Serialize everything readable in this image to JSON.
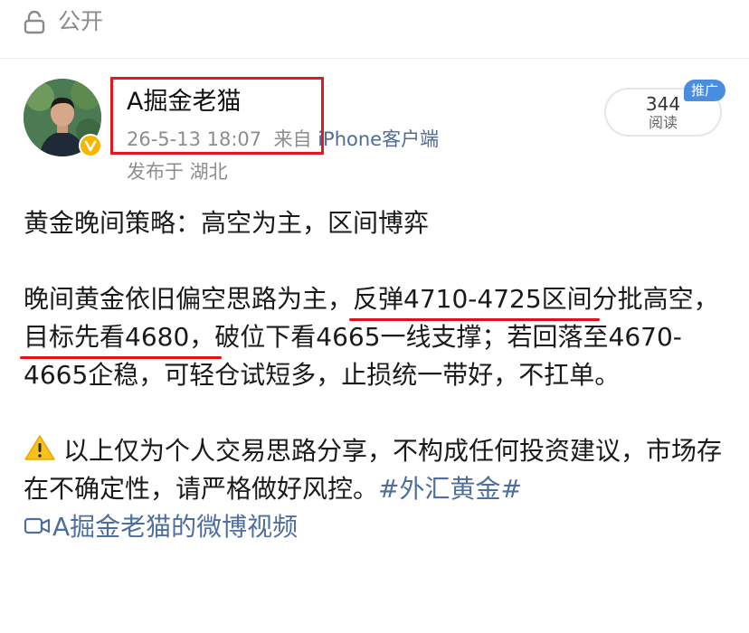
{
  "header": {
    "visibility_label": "公开",
    "visibility_icon": "lock-icon"
  },
  "post": {
    "author": "A掘金老猫",
    "timestamp": "26-5-13 18:07",
    "source_prefix": "来自",
    "source": "iPhone客户端",
    "location": "发布于 湖北",
    "views": {
      "count": "344",
      "label": "阅读"
    },
    "promo_badge": "推广",
    "title_line": "黄金晚间策略：高空为主，区间博弈",
    "body": {
      "seg1": "晚间黄金依旧偏空思路为主，",
      "seg2": "反弹4710-4725区间",
      "seg3": "分批高空，",
      "seg4": "目标先看4680，",
      "seg5": "破位下看4665一线支撑；若回落至4670-4665企稳，可轻仓试短多，止损统一带好，不扛单。"
    },
    "disclaimer_icon": "warning-icon",
    "disclaimer": "以上仅为个人交易思路分享，不构成任何投资建议，市场存在不确定性，请严格做好风控。",
    "topic": "#外汇黄金#",
    "video_link": "A掘金老猫的微博视频",
    "video_icon": "video-camera-icon"
  },
  "colors": {
    "highlight": "#e4191f",
    "link": "#4d6e9f",
    "muted": "#8d8d8d",
    "promo": "#4a8dde",
    "verified": "#f6b600"
  }
}
